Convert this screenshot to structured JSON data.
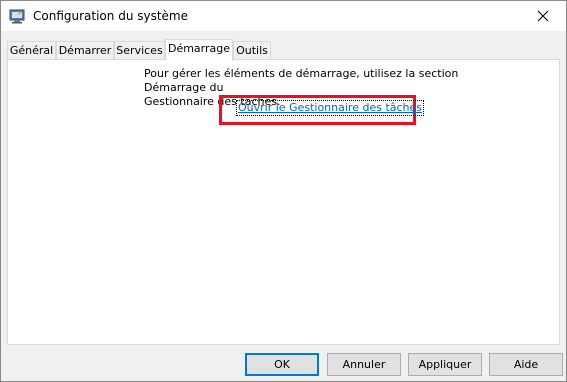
{
  "window": {
    "title": "Configuration du système"
  },
  "tabs": [
    {
      "label": "Général"
    },
    {
      "label": "Démarrer"
    },
    {
      "label": "Services"
    },
    {
      "label": "Démarrage",
      "active": true
    },
    {
      "label": "Outils"
    }
  ],
  "startup": {
    "info_line1": "Pour gérer les éléments de démarrage, utilisez la section Démarrage du",
    "info_line2": "Gestionnaire des tâches.",
    "link_label": "Ouvrir le Gestionnaire des tâches"
  },
  "buttons": {
    "ok": "OK",
    "cancel": "Annuler",
    "apply": "Appliquer",
    "help": "Aide"
  },
  "icons": {
    "app": "system-configuration-icon",
    "close": "close-icon"
  },
  "colors": {
    "highlight": "#e81123",
    "link": "#0066cc",
    "default_button_border": "#0078d7"
  }
}
